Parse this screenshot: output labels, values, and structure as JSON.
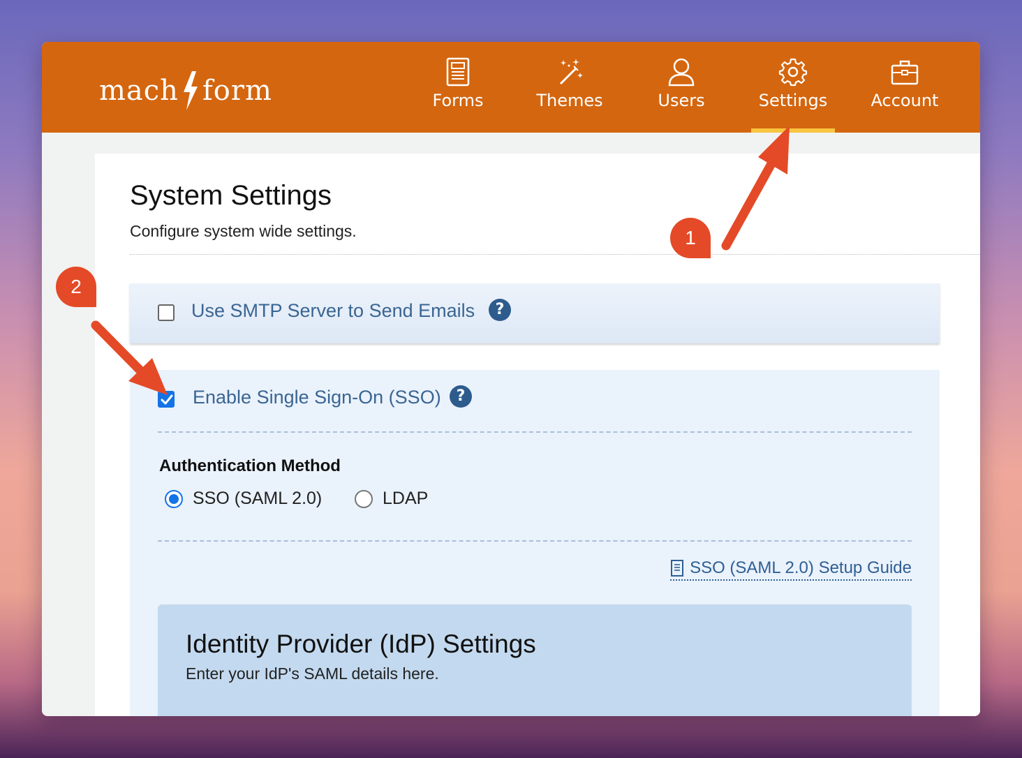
{
  "app": {
    "logo_left": "mach",
    "logo_right": "form"
  },
  "nav": {
    "items": [
      {
        "label": "Forms",
        "icon": "form-document-icon"
      },
      {
        "label": "Themes",
        "icon": "magic-wand-icon"
      },
      {
        "label": "Users",
        "icon": "user-icon"
      },
      {
        "label": "Settings",
        "icon": "gear-icon",
        "active": true
      },
      {
        "label": "Account",
        "icon": "briefcase-icon"
      }
    ]
  },
  "page": {
    "title": "System Settings",
    "subtitle": "Configure system wide settings."
  },
  "smtp": {
    "label": "Use SMTP Server to Send Emails",
    "checked": false,
    "help": "?"
  },
  "sso": {
    "label": "Enable Single Sign-On (SSO)",
    "checked": true,
    "help": "?",
    "auth_method_title": "Authentication Method",
    "options": [
      {
        "label": "SSO (SAML 2.0)",
        "selected": true
      },
      {
        "label": "LDAP",
        "selected": false
      }
    ],
    "guide_link": "SSO (SAML 2.0) Setup Guide"
  },
  "idp": {
    "title": "Identity Provider (IdP) Settings",
    "subtitle": "Enter your IdP's SAML details here."
  },
  "annotations": {
    "callout_1": "1",
    "callout_2": "2"
  },
  "colors": {
    "topbar": "#d4660f",
    "active_underline": "#f9c440",
    "accent_blue": "#1473e6",
    "callout": "#e44a27",
    "idp_panel": "#c3d9ef"
  }
}
